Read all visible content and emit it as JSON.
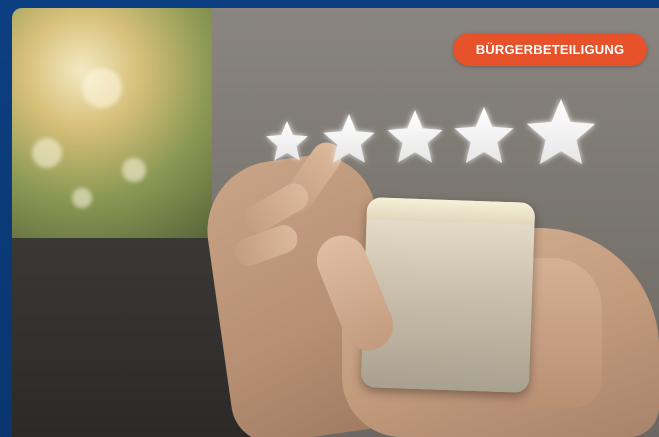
{
  "card": {
    "badge_label": "BÜRGERBETEILIGUNG",
    "accent_color": "#e8522a",
    "frame_color": "#0b3a78"
  },
  "image": {
    "rating_stars": 5,
    "star_icon": "star-icon"
  }
}
